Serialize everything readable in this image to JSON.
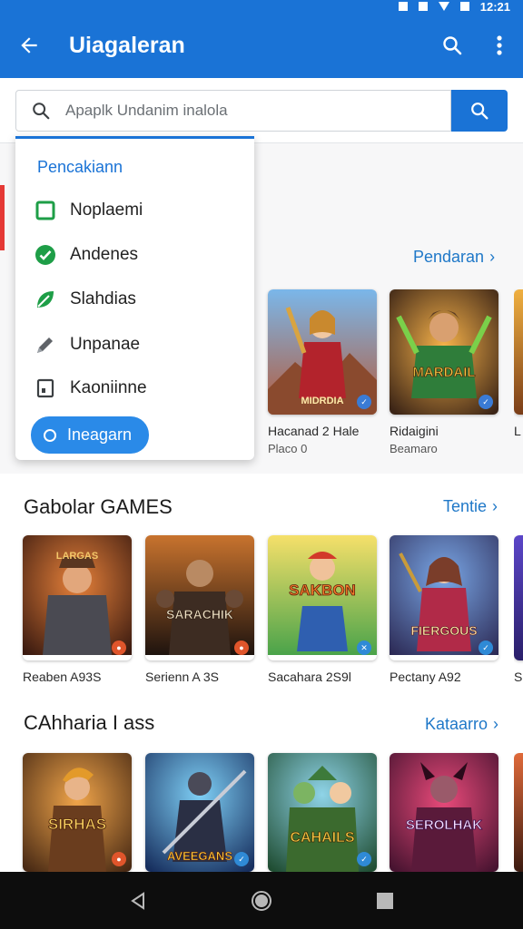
{
  "status": {
    "time": "12:21"
  },
  "app_bar": {
    "title": "Uiagaleran"
  },
  "search": {
    "placeholder": "Apaplk Undanim inalola"
  },
  "dropdown": {
    "header": "Pencakiann",
    "items": [
      {
        "label": "Noplaemi",
        "icon": "checkbox-icon",
        "color": "#1e9e47"
      },
      {
        "label": "Andenes",
        "icon": "check-circle-icon",
        "color": "#1e9e47"
      },
      {
        "label": "Slahdias",
        "icon": "leaf-icon",
        "color": "#1e9e47"
      },
      {
        "label": "Unpanae",
        "icon": "pencil-icon",
        "color": "#5f6368"
      },
      {
        "label": "Kaoniinne",
        "icon": "document-icon",
        "color": "#3c4043"
      }
    ],
    "apply_label": "Ineagarn"
  },
  "featured": {
    "see_all": "Pendaran",
    "tiles": [
      {
        "name": "Hacanad 2 Hale",
        "sub": "Placo 0",
        "art_label": "MIDRDIA"
      },
      {
        "name": "Ridaigini",
        "sub": "Beamaro",
        "art_label": "MARDAIL"
      },
      {
        "name": "L",
        "sub": ""
      }
    ]
  },
  "popular": {
    "title": "Gabolar GAMES",
    "see_all": "Tentie",
    "tiles": [
      {
        "name": "Reaben A93S",
        "art_label": "LARGAS"
      },
      {
        "name": "Serienn A 3S",
        "art_label": "SARACHIK"
      },
      {
        "name": "Sacahara 2S9l",
        "art_label": "SAKBON"
      },
      {
        "name": "Pectany A92",
        "art_label": "FIERGOUS"
      },
      {
        "name": "S",
        "art_label": ""
      }
    ]
  },
  "casual": {
    "title": "CAhharia I ass",
    "see_all": "Kataarro",
    "tiles": [
      {
        "name": "",
        "art_label": "SIRHAS"
      },
      {
        "name": "",
        "art_label": "AVEEGANS"
      },
      {
        "name": "",
        "art_label": "CAHAILS"
      },
      {
        "name": "",
        "art_label": "SEROLHAK"
      }
    ]
  },
  "colors": {
    "primary": "#1a73d6",
    "link": "#1f78c8",
    "danger": "#e53935"
  }
}
